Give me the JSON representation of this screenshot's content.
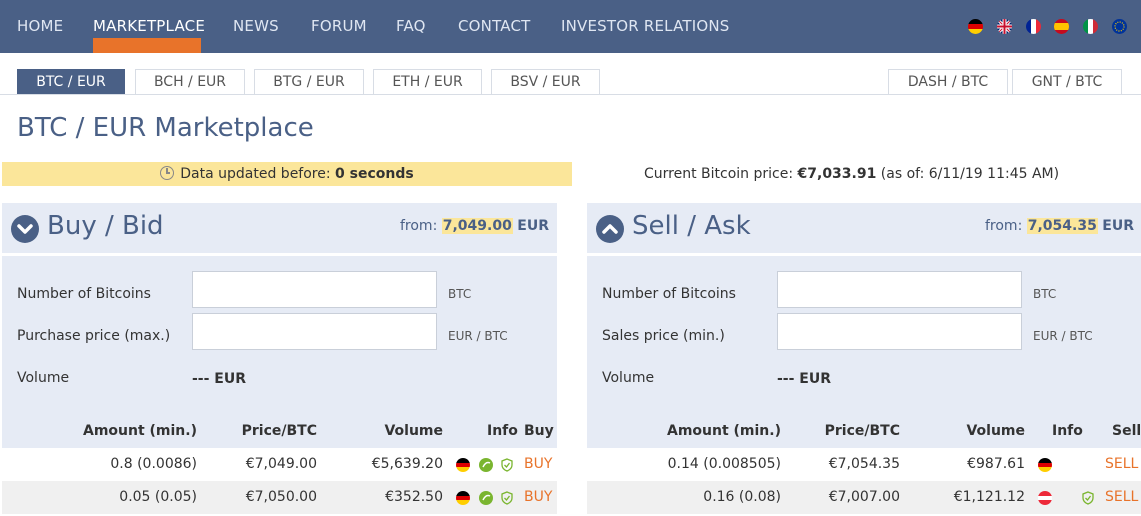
{
  "nav": {
    "items": [
      {
        "label": "HOME"
      },
      {
        "label": "MARKETPLACE"
      },
      {
        "label": "NEWS"
      },
      {
        "label": "FORUM"
      },
      {
        "label": "FAQ"
      },
      {
        "label": "CONTACT"
      },
      {
        "label": "INVESTOR RELATIONS"
      }
    ],
    "active_index": 1,
    "flags": [
      "germany-flag-icon",
      "uk-flag-icon",
      "france-flag-icon",
      "spain-flag-icon",
      "italy-flag-icon",
      "eu-flag-icon"
    ]
  },
  "pairs": {
    "left": [
      "BTC / EUR",
      "BCH / EUR",
      "BTG / EUR",
      "ETH / EUR",
      "BSV / EUR"
    ],
    "right": [
      "DASH / BTC",
      "GNT / BTC"
    ],
    "active": "BTC / EUR"
  },
  "page_title": "BTC / EUR Marketplace",
  "status": {
    "prefix": "Data updated before:",
    "value": "0 seconds"
  },
  "current_price": {
    "label": "Current Bitcoin price:",
    "value": "€7,033.91",
    "asof": "(as of: 6/11/19 11:45 AM)"
  },
  "buy": {
    "title": "Buy / Bid",
    "from_label": "from:",
    "from_value": "7,049.00",
    "from_currency": "EUR",
    "fields": {
      "amount_label": "Number of Bitcoins",
      "amount_unit": "BTC",
      "price_label": "Purchase price (max.)",
      "price_unit": "EUR / BTC",
      "volume_label": "Volume",
      "volume_value": "--- EUR"
    },
    "columns": [
      "Amount (min.)",
      "Price/BTC",
      "Volume",
      "Info",
      "Buy"
    ],
    "rows": [
      {
        "amount": "0.8 (0.0086)",
        "price": "€7,049.00",
        "volume": "€5,639.20",
        "action": "BUY"
      },
      {
        "amount": "0.05 (0.05)",
        "price": "€7,050.00",
        "volume": "€352.50",
        "action": "BUY"
      }
    ]
  },
  "sell": {
    "title": "Sell / Ask",
    "from_label": "from:",
    "from_value": "7,054.35",
    "from_currency": "EUR",
    "fields": {
      "amount_label": "Number of Bitcoins",
      "amount_unit": "BTC",
      "price_label": "Sales price (min.)",
      "price_unit": "EUR / BTC",
      "volume_label": "Volume",
      "volume_value": "--- EUR"
    },
    "columns": [
      "Amount (min.)",
      "Price/BTC",
      "Volume",
      "Info",
      "Sell"
    ],
    "rows": [
      {
        "amount": "0.14 (0.008505)",
        "price": "€7,054.35",
        "volume": "€987.61",
        "action": "SELL"
      },
      {
        "amount": "0.16 (0.08)",
        "price": "€7,007.00",
        "volume": "€1,121.12",
        "action": "SELL"
      }
    ]
  },
  "colors": {
    "nav_bg": "#4a6086",
    "accent": "#e8732a",
    "highlight": "#fbe69a",
    "panel_bg": "#e6ebf5"
  }
}
